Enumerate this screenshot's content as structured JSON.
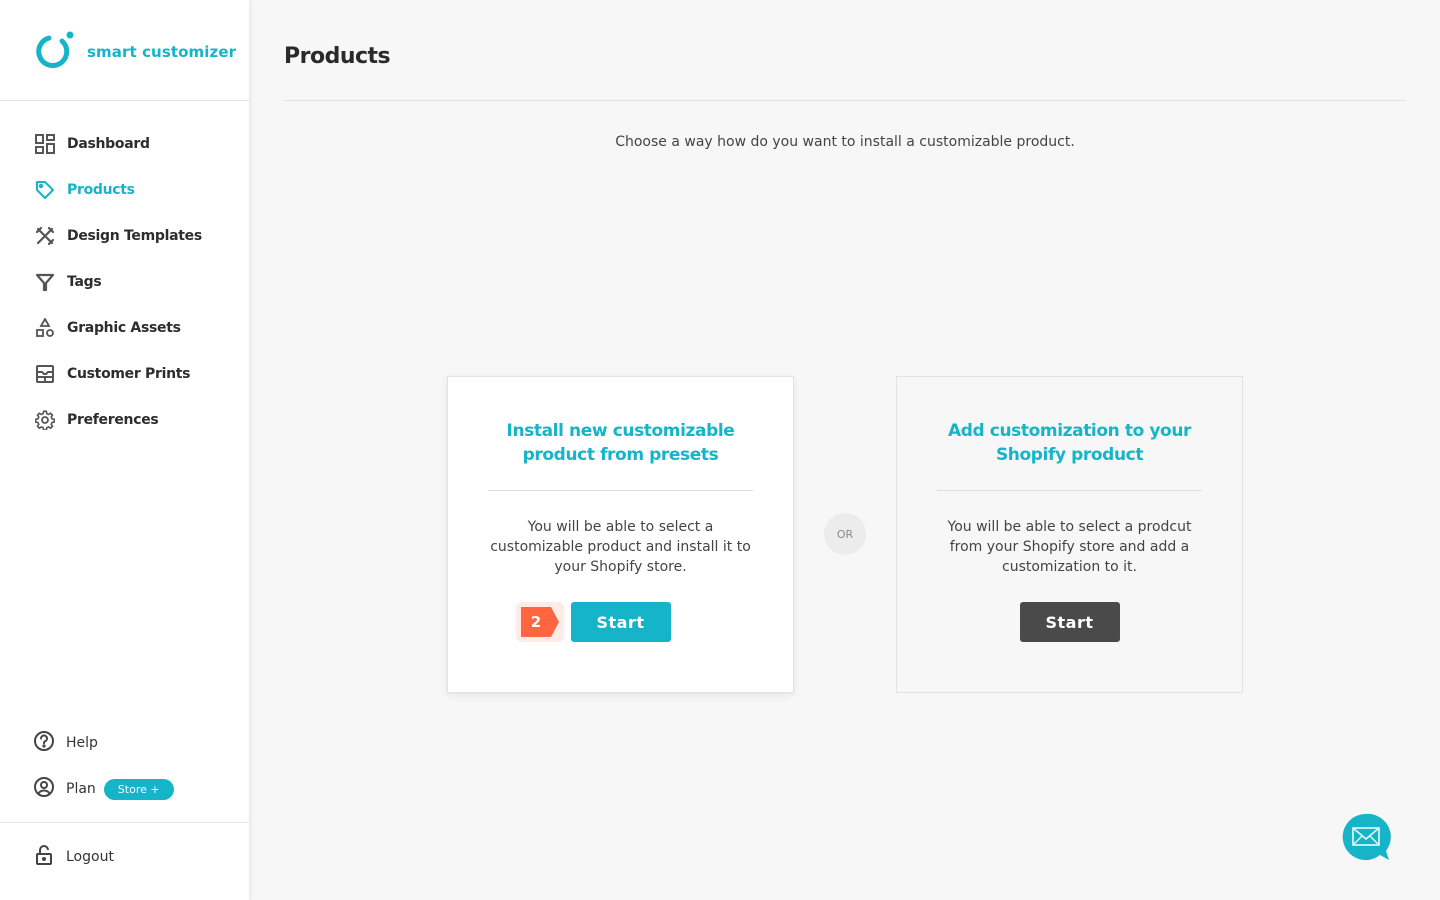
{
  "brand": {
    "name": "smart customizer",
    "accent_color": "#16b4c8"
  },
  "sidebar": {
    "items": [
      {
        "label": "Dashboard",
        "icon": "dashboard-icon",
        "active": false
      },
      {
        "label": "Products",
        "icon": "tag-icon",
        "active": true
      },
      {
        "label": "Design Templates",
        "icon": "design-tools-icon",
        "active": false
      },
      {
        "label": "Tags",
        "icon": "filter-icon",
        "active": false
      },
      {
        "label": "Graphic Assets",
        "icon": "shapes-icon",
        "active": false
      },
      {
        "label": "Customer Prints",
        "icon": "prints-icon",
        "active": false
      },
      {
        "label": "Preferences",
        "icon": "gear-icon",
        "active": false
      }
    ],
    "help_label": "Help",
    "plan_label": "Plan",
    "plan_badge": "Store +",
    "logout_label": "Logout"
  },
  "main": {
    "title": "Products",
    "subtitle": "Choose a way how do you want to install a customizable product.",
    "or_label": "OR",
    "cards": [
      {
        "title": "Install new customizable product from presets",
        "description": "You will be able to select a customizable product and install it to your Shopify store.",
        "button_label": "Start",
        "step_number": "2",
        "step_color": "#ff6540"
      },
      {
        "title": "Add customization to your Shopify product",
        "description": "You will be able to select a prodcut from your Shopify store and add a customization to it.",
        "button_label": "Start"
      }
    ]
  },
  "chat": {
    "icon": "mail-icon"
  }
}
